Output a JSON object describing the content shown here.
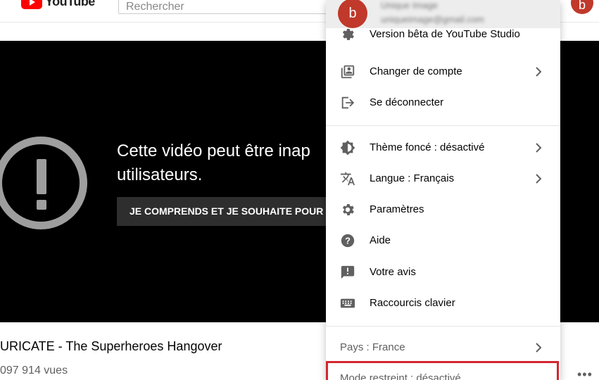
{
  "header": {
    "logo_text": "YouTube",
    "search_placeholder": "Rechercher",
    "avatar_letter": "b"
  },
  "player": {
    "warning_line1": "Cette vidéo peut être inap",
    "warning_line2": "utilisateurs.",
    "accept_button": "JE COMPRENDS ET JE SOUHAITE POUR"
  },
  "video": {
    "title": "URICATE - The Superheroes Hangover",
    "views": "097 914 vues",
    "more_label": "•••"
  },
  "menu": {
    "avatar_letter": "b",
    "account_name": "Unique Image",
    "account_email": "uniqueimage@gmail.com",
    "studio_beta": "Version bêta de YouTube Studio",
    "items_top": [
      {
        "label": "Changer de compte"
      },
      {
        "label": "Se déconnecter"
      }
    ],
    "items_mid": [
      {
        "label": "Thème foncé : désactivé"
      },
      {
        "label": "Langue : Français"
      },
      {
        "label": "Paramètres"
      },
      {
        "label": "Aide"
      },
      {
        "label": "Votre avis"
      },
      {
        "label": "Raccourcis clavier"
      }
    ],
    "items_bottom": [
      {
        "label": "Pays : France"
      },
      {
        "label": "Mode restreint : désactivé"
      }
    ]
  },
  "colors": {
    "brand_red": "#ff0000",
    "avatar": "#c0392b",
    "highlight": "#d22630"
  }
}
